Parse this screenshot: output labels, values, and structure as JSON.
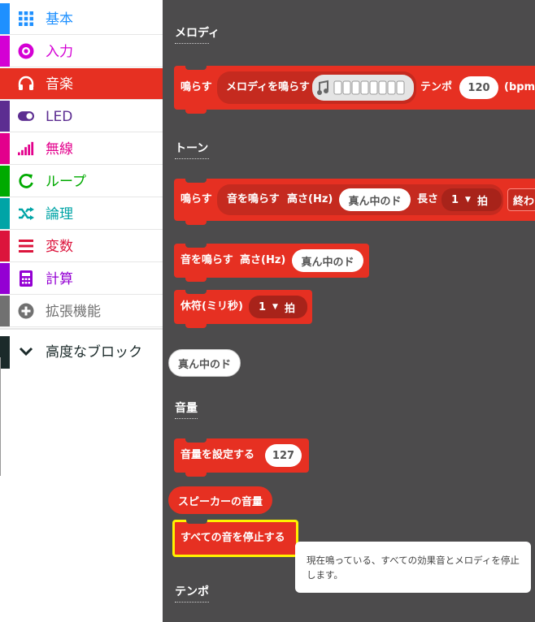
{
  "sidebar": {
    "categories": [
      {
        "label": "基本",
        "icon": "grid-icon",
        "color": "#1e90ff",
        "selected": false
      },
      {
        "label": "入力",
        "icon": "target-icon",
        "color": "#d400d4",
        "selected": false
      },
      {
        "label": "音楽",
        "icon": "headphones-icon",
        "color": "#e63022",
        "selected": true
      },
      {
        "label": "LED",
        "icon": "toggle-icon",
        "color": "#5c2d91",
        "selected": false
      },
      {
        "label": "無線",
        "icon": "signal-bars-icon",
        "color": "#e3008c",
        "selected": false
      },
      {
        "label": "ループ",
        "icon": "loop-icon",
        "color": "#00aa00",
        "selected": false
      },
      {
        "label": "論理",
        "icon": "shuffle-icon",
        "color": "#00a4a6",
        "selected": false
      },
      {
        "label": "変数",
        "icon": "list-icon",
        "color": "#dc143c",
        "selected": false
      },
      {
        "label": "計算",
        "icon": "calculator-icon",
        "color": "#9400d3",
        "selected": false
      },
      {
        "label": "拡張機能",
        "icon": "plus-circle-icon",
        "color": "#717171",
        "selected": false
      }
    ],
    "advanced": {
      "label": "高度なブロック",
      "icon": "chevron-down-icon",
      "color": "#1b2a2a"
    }
  },
  "workspace": {
    "section_melody": "メロディ",
    "play_block": {
      "label": "鳴らす",
      "inner": "メロディを鳴らす",
      "tempo_label": "テンポ",
      "tempo_value": "120",
      "tempo_unit": "(bpm)"
    },
    "section_tone": "トーン",
    "play_tone_block": {
      "label": "鳴らす",
      "inner": "音を鳴らす",
      "pitch_label": "高さ(Hz)",
      "pitch_value": "真ん中のド",
      "length_label": "長さ",
      "beat_value": "1",
      "beat_unit": "拍",
      "until_label": "終わ"
    },
    "ring_tone_block": {
      "label": "音を鳴らす",
      "pitch_label": "高さ(Hz)",
      "pitch_value": "真ん中のド"
    },
    "rest_block": {
      "label": "休符(ミリ秒)",
      "beat_value": "1",
      "beat_unit": "拍"
    },
    "note_reporter": "真ん中のド",
    "section_volume": "音量",
    "set_volume_block": {
      "label": "音量を設定する",
      "value": "127"
    },
    "speaker_volume_reporter": "スピーカーの音量",
    "stop_all_block": {
      "label": "すべての音を停止する"
    },
    "section_tempo": "テンポ",
    "tooltip": "現在鳴っている、すべての効果音とメロディを停止します。"
  },
  "colors": {
    "music": "#e63022",
    "workspace": "#4c4b4c",
    "highlight": "#fff200"
  }
}
